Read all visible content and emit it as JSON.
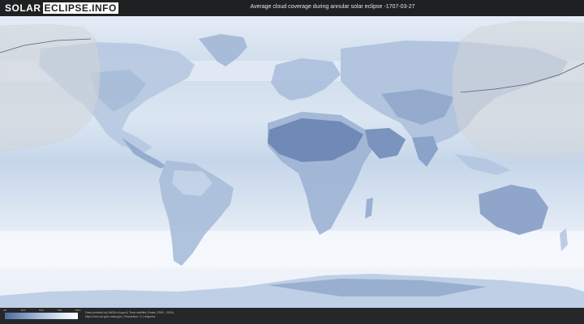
{
  "header": {
    "logo_left": "SOLAR",
    "logo_right": "ECLIPSE.INFO",
    "title": "Average cloud coverage during annular solar eclipse -1707-03-27"
  },
  "legend": {
    "ticks": [
      "0%",
      "25%",
      "50%",
      "75%",
      "100%"
    ],
    "colors": [
      "#4d6a9a",
      "#7c97c0",
      "#a9bfdc",
      "#d6e3f1",
      "#ffffff"
    ]
  },
  "credits": {
    "line1": "Data provided by NASA's Aqua & Terra satellite (Years: 2000 - 2019)",
    "line2": "https://neo.sci.gsfc.nasa.gov  |  Resolution: 0.1 degrees"
  },
  "colors": {
    "ocean_base": "#c9d8ea",
    "land_dark": "#6f8ab6",
    "eclipse_zone": "#d3d6d9"
  }
}
